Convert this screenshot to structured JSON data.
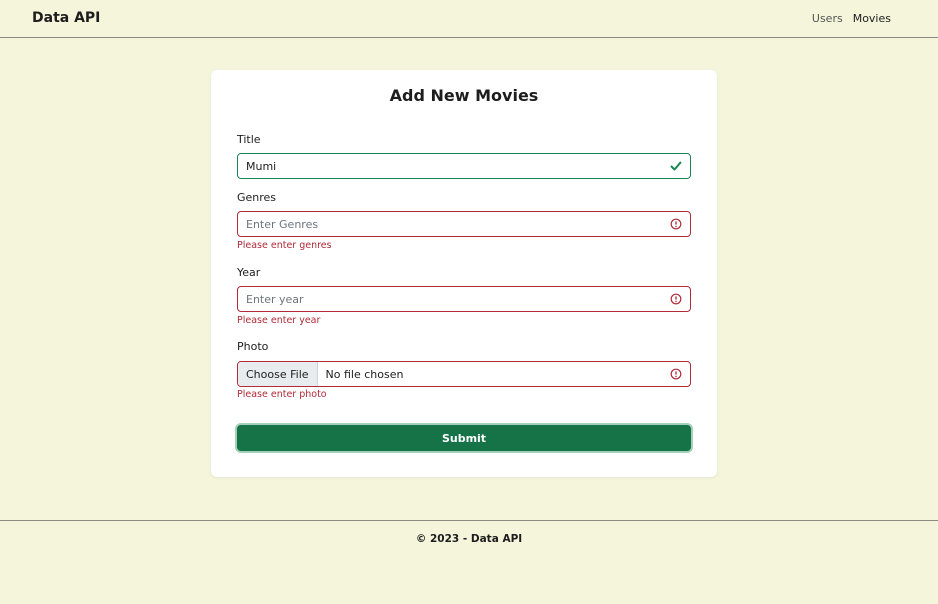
{
  "navbar": {
    "brand": "Data API",
    "links": [
      {
        "label": "Users"
      },
      {
        "label": "Movies"
      }
    ]
  },
  "form": {
    "title": "Add New Movies",
    "fields": {
      "title": {
        "label": "Title",
        "value": "Mumi",
        "status": "valid"
      },
      "genres": {
        "label": "Genres",
        "placeholder": "Enter Genres",
        "error": "Please enter genres",
        "status": "invalid"
      },
      "year": {
        "label": "Year",
        "placeholder": "Enter year",
        "error": "Please enter year",
        "status": "invalid"
      },
      "photo": {
        "label": "Photo",
        "button_label": "Choose File",
        "status_text": "No file chosen",
        "error": "Please enter photo",
        "status": "invalid"
      }
    },
    "submit_label": "Submit"
  },
  "footer": {
    "text": "© 2023 - Data API"
  },
  "icons": {
    "valid": "check-icon",
    "invalid": "alert-circle-icon"
  },
  "colors": {
    "background": "#f5f5dc",
    "primary": "#157347",
    "valid": "#198754",
    "error": "#b02a37"
  }
}
